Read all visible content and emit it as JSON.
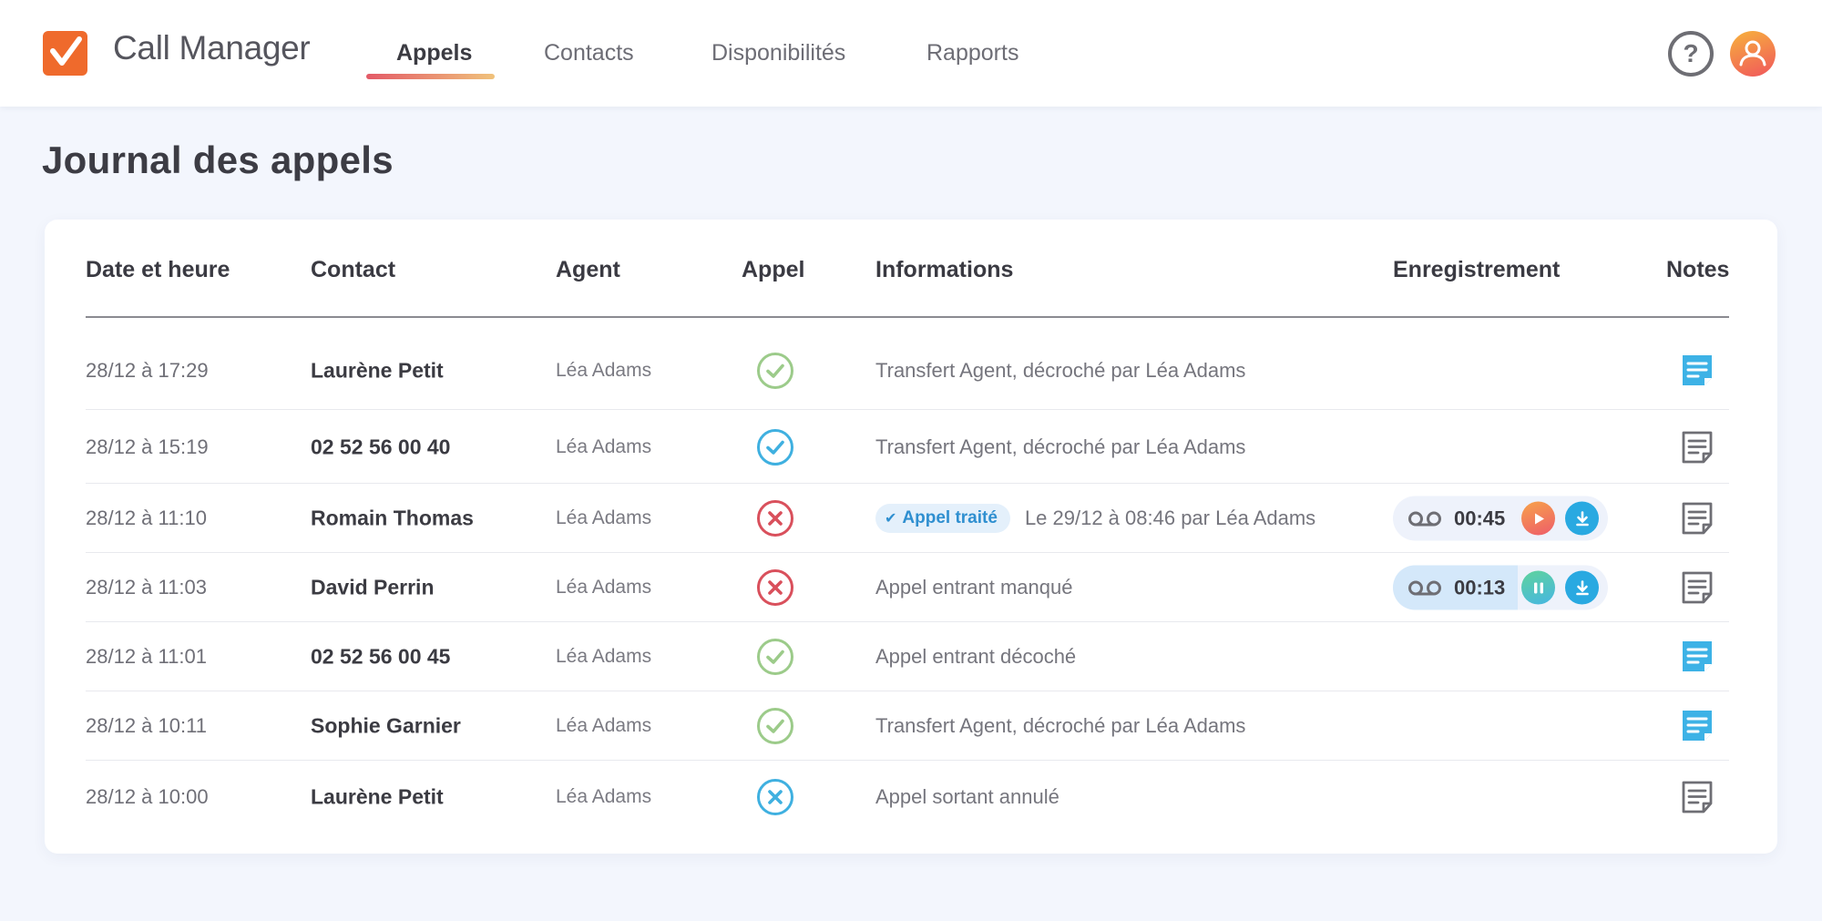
{
  "app": {
    "title": "Call Manager",
    "accent_color": "#ef6a2c"
  },
  "nav": {
    "tabs": [
      {
        "label": "Appels",
        "active": true
      },
      {
        "label": "Contacts",
        "active": false
      },
      {
        "label": "Disponibilités",
        "active": false
      },
      {
        "label": "Rapports",
        "active": false
      }
    ],
    "help_label": "?",
    "help_icon": "help-circle-icon",
    "avatar_icon": "user-icon"
  },
  "page": {
    "title": "Journal des appels"
  },
  "table": {
    "columns": {
      "date": "Date et heure",
      "contact": "Contact",
      "agent": "Agent",
      "call": "Appel",
      "info": "Informations",
      "recording": "Enregistrement",
      "notes": "Notes"
    },
    "rows": [
      {
        "date": "28/12 à 17:29",
        "contact": "Laurène Petit",
        "agent": "Léa Adams",
        "status": "answered",
        "info": "Transfert Agent, décroché par Léa Adams",
        "has_note": true
      },
      {
        "date": "28/12 à 15:19",
        "contact": "02 52 56 00 40",
        "agent": "Léa Adams",
        "status": "answered-blue",
        "info": "Transfert Agent, décroché par Léa Adams",
        "has_note": false
      },
      {
        "date": "28/12 à 11:10",
        "contact": "Romain Thomas",
        "agent": "Léa Adams",
        "status": "missed",
        "badge": "Appel traité",
        "info": "Le 29/12 à 08:46 par Léa Adams",
        "recording": {
          "duration": "00:45",
          "state": "paused",
          "progress": 0
        },
        "has_note": false
      },
      {
        "date": "28/12 à 11:03",
        "contact": "David Perrin",
        "agent": "Léa Adams",
        "status": "missed",
        "info": "Appel entrant manqué",
        "recording": {
          "duration": "00:13",
          "state": "playing",
          "progress": 0.58
        },
        "has_note": false
      },
      {
        "date": "28/12 à 11:01",
        "contact": "02 52 56 00 45",
        "agent": "Léa Adams",
        "status": "answered",
        "info": "Appel entrant décoché",
        "has_note": true
      },
      {
        "date": "28/12 à 10:11",
        "contact": "Sophie Garnier",
        "agent": "Léa Adams",
        "status": "answered",
        "info": "Transfert Agent, décroché par Léa Adams",
        "has_note": true
      },
      {
        "date": "28/12 à 10:00",
        "contact": "Laurène Petit",
        "agent": "Léa Adams",
        "status": "cancelled",
        "info": "Appel sortant annulé",
        "has_note": false
      }
    ]
  },
  "colors": {
    "answered": "#9ccb8a",
    "answered_blue": "#3fb0e0",
    "missed": "#d9505c",
    "cancelled": "#3fb0e0",
    "note_filled": "#3db2e6",
    "note_empty": "#6e6e74"
  }
}
